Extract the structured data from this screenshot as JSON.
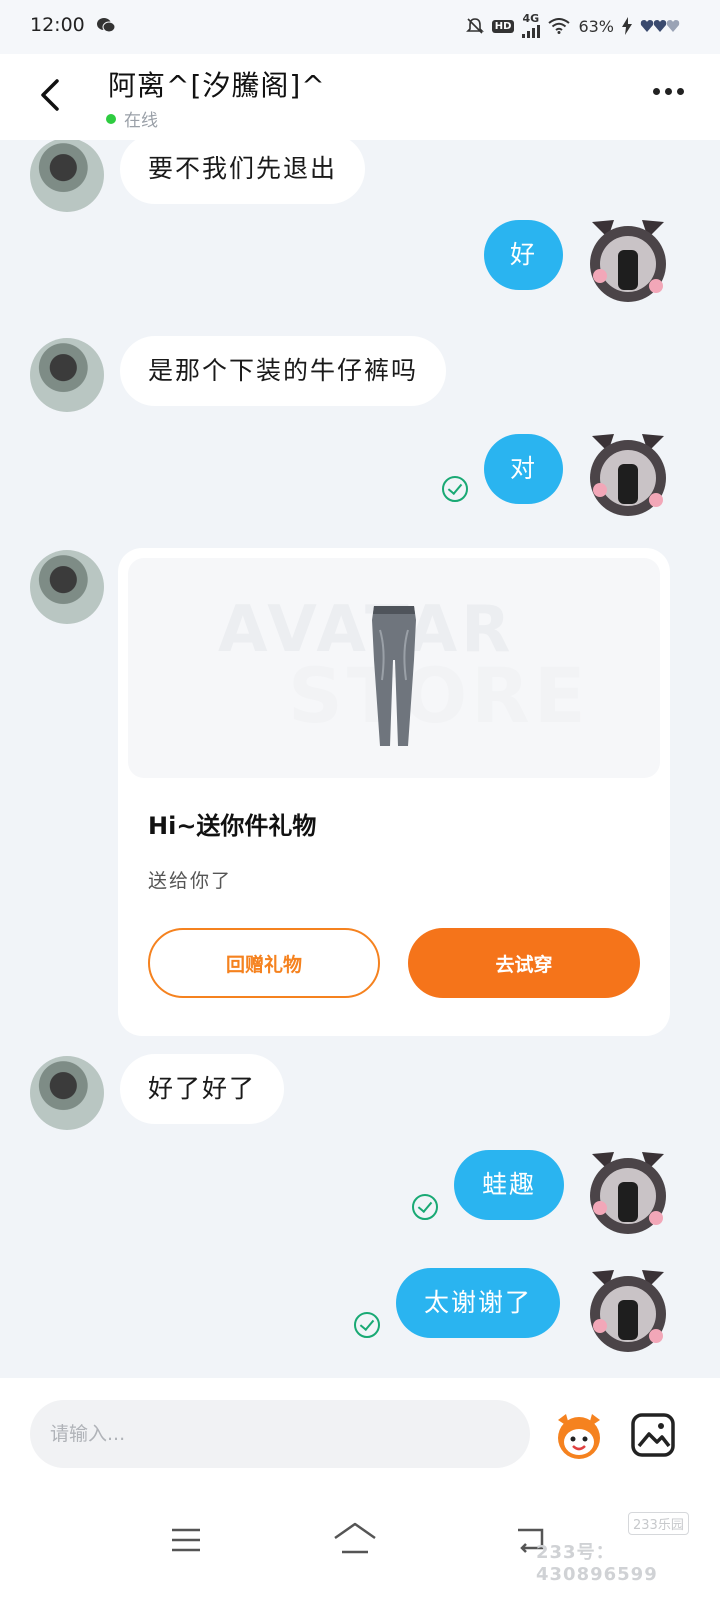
{
  "status_bar": {
    "time": "12:00",
    "hd": "HD",
    "network": "4G",
    "battery": "63%",
    "icons": [
      "wechat-icon",
      "mute-icon",
      "signal-icon",
      "wifi-icon",
      "charging-icon",
      "hearts-icon"
    ]
  },
  "header": {
    "title": "阿离^[汐騰阁]^",
    "status": "在线",
    "back_icon": "chevron-left-icon",
    "more_icon": "more-dots-icon"
  },
  "messages": [
    {
      "side": "in",
      "text": "要不我们先退出"
    },
    {
      "side": "out",
      "text": "好"
    },
    {
      "side": "in",
      "text": "是那个下装的牛仔裤吗"
    },
    {
      "side": "out",
      "text": "对",
      "read": true
    },
    {
      "side": "in",
      "type": "gift"
    },
    {
      "side": "in",
      "text": "好了好了"
    },
    {
      "side": "out",
      "text": "蛙趣",
      "read": true
    },
    {
      "side": "out",
      "text": "太谢谢了",
      "read": true
    }
  ],
  "gift": {
    "watermark_1": "AVATAR",
    "watermark_2": "STORE",
    "title": "Hi~送你件礼物",
    "subtitle": "送给你了",
    "return_label": "回赠礼物",
    "try_label": "去试穿"
  },
  "input": {
    "placeholder": "请输入..."
  },
  "watermark": {
    "logo": "233乐园",
    "id": "233号：430896599"
  },
  "colors": {
    "accent_blue": "#2ab4f0",
    "accent_orange": "#f5741a",
    "read_green": "#19a974",
    "background": "#f1f4f8"
  }
}
